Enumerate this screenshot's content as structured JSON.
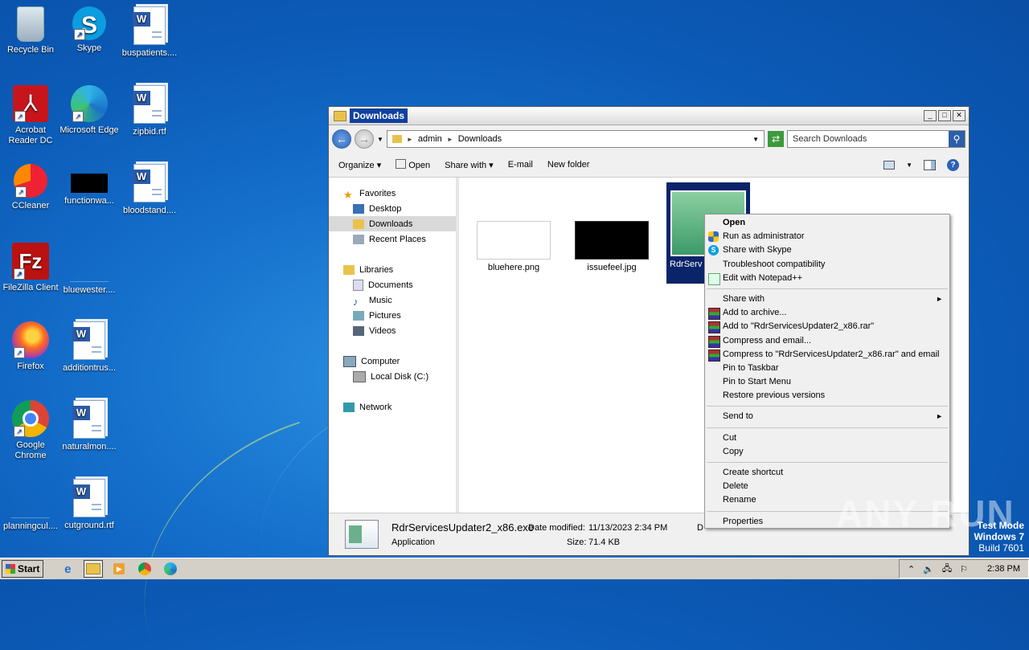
{
  "desktop": {
    "icons": [
      {
        "label": "Recycle Bin",
        "icon": "recycle-bin-icon"
      },
      {
        "label": "Skype",
        "icon": "skype-icon"
      },
      {
        "label": "buspatients....",
        "icon": "word-document-icon"
      },
      {
        "label": "Acrobat Reader DC",
        "icon": "acrobat-icon"
      },
      {
        "label": "Microsoft Edge",
        "icon": "edge-icon"
      },
      {
        "label": "zipbid.rtf",
        "icon": "word-document-icon"
      },
      {
        "label": "CCleaner",
        "icon": "ccleaner-icon"
      },
      {
        "label": "functionwa...",
        "icon": "black-image-icon"
      },
      {
        "label": "bloodstand....",
        "icon": "word-document-icon"
      },
      {
        "label": "FileZilla Client",
        "icon": "filezilla-icon"
      },
      {
        "label": "bluewester....",
        "icon": "blank-file-icon"
      },
      {
        "label": "Firefox",
        "icon": "firefox-icon"
      },
      {
        "label": "additiontrus...",
        "icon": "word-document-icon"
      },
      {
        "label": "Google Chrome",
        "icon": "chrome-icon"
      },
      {
        "label": "naturalmon....",
        "icon": "word-document-icon"
      },
      {
        "label": "planningcul....",
        "icon": "blank-file-icon"
      },
      {
        "label": "cutground.rtf",
        "icon": "word-document-icon"
      }
    ]
  },
  "window": {
    "title": "Downloads",
    "address": {
      "crumb1": "admin",
      "crumb2": "Downloads"
    },
    "search_placeholder": "Search Downloads",
    "toolbar": {
      "organize": "Organize",
      "open": "Open",
      "share_with": "Share with",
      "email": "E-mail",
      "new_folder": "New folder"
    },
    "nav": {
      "favorites": "Favorites",
      "desktop": "Desktop",
      "downloads": "Downloads",
      "recent_places": "Recent Places",
      "libraries": "Libraries",
      "documents": "Documents",
      "music": "Music",
      "pictures": "Pictures",
      "videos": "Videos",
      "computer": "Computer",
      "local_disk": "Local Disk (C:)",
      "network": "Network"
    },
    "files": [
      {
        "name": "bluehere.png"
      },
      {
        "name": "issuefeel.jpg"
      },
      {
        "name": "RdrServ r2_x"
      }
    ],
    "status": {
      "filename": "RdrServicesUpdater2_x86.exe",
      "type": "Application",
      "modified_label": "Date modified:",
      "modified_value": "11/13/2023 2:34 PM",
      "size_label": "Size:",
      "size_value": "71.4 KB",
      "extra": "D"
    }
  },
  "context_menu": {
    "open": "Open",
    "run_as_admin": "Run as administrator",
    "share_skype": "Share with Skype",
    "troubleshoot": "Troubleshoot compatibility",
    "edit_notepad": "Edit with Notepad++",
    "share_with": "Share with",
    "add_archive": "Add to archive...",
    "add_rar": "Add to \"RdrServicesUpdater2_x86.rar\"",
    "compress_email": "Compress and email...",
    "compress_rar_email": "Compress to \"RdrServicesUpdater2_x86.rar\" and email",
    "pin_taskbar": "Pin to Taskbar",
    "pin_start": "Pin to Start Menu",
    "restore": "Restore previous versions",
    "send_to": "Send to",
    "cut": "Cut",
    "copy": "Copy",
    "create_shortcut": "Create shortcut",
    "delete": "Delete",
    "rename": "Rename",
    "properties": "Properties"
  },
  "watermark": "ANY RUN",
  "test_mode": {
    "line1": "Test Mode",
    "line2": "Windows 7",
    "line3": "Build 7601"
  },
  "taskbar": {
    "start": "Start",
    "clock": "2:38 PM"
  }
}
